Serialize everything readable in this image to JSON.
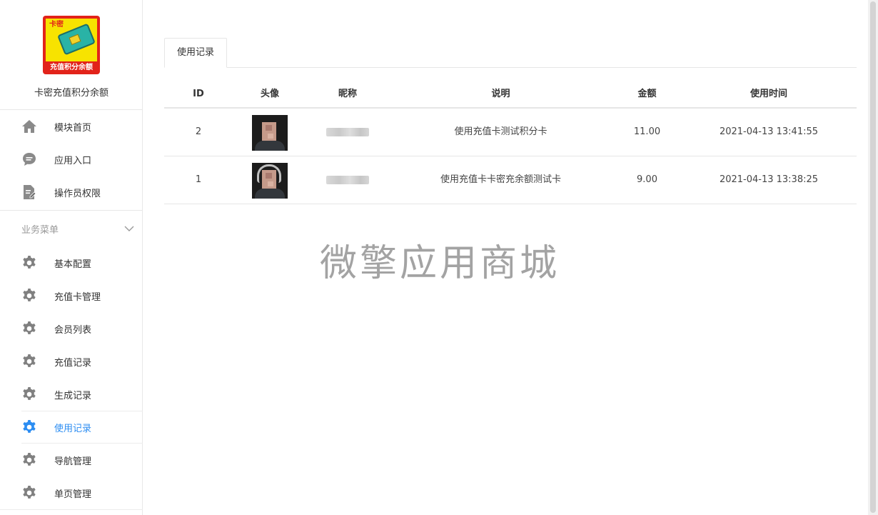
{
  "app": {
    "logo_corner": "卡密",
    "logo_caption": "充值积分余额",
    "name": "卡密充值积分余额"
  },
  "sidebar": {
    "top_items": [
      {
        "label": "模块首页",
        "icon": "home-icon"
      },
      {
        "label": "应用入口",
        "icon": "chat-bubble-icon"
      },
      {
        "label": "操作员权限",
        "icon": "document-edit-icon"
      }
    ],
    "group": {
      "label": "业务菜单",
      "icon": "chevron-down-icon"
    },
    "biz_items": [
      {
        "label": "基本配置",
        "icon": "gear-icon"
      },
      {
        "label": "充值卡管理",
        "icon": "gear-icon"
      },
      {
        "label": "会员列表",
        "icon": "gear-icon"
      },
      {
        "label": "充值记录",
        "icon": "gear-icon"
      },
      {
        "label": "生成记录",
        "icon": "gear-icon"
      },
      {
        "label": "使用记录",
        "icon": "gear-icon",
        "active": true
      },
      {
        "label": "导航管理",
        "icon": "gear-icon"
      },
      {
        "label": "单页管理",
        "icon": "gear-icon"
      }
    ]
  },
  "main": {
    "tab": "使用记录",
    "columns": [
      "ID",
      "头像",
      "昵称",
      "说明",
      "金额",
      "使用时间"
    ],
    "rows": [
      {
        "id": "2",
        "description": "使用充值卡测试积分卡",
        "amount": "11.00",
        "time": "2021-04-13 13:41:55"
      },
      {
        "id": "1",
        "description": "使用充值卡卡密充余额测试卡",
        "amount": "9.00",
        "time": "2021-04-13 13:38:25"
      }
    ]
  },
  "watermark": "微擎应用商城",
  "colors": {
    "accent": "#2c8df2",
    "icon_gray": "#808080",
    "logo_red": "#e2231a",
    "logo_yellow": "#f7e300"
  }
}
